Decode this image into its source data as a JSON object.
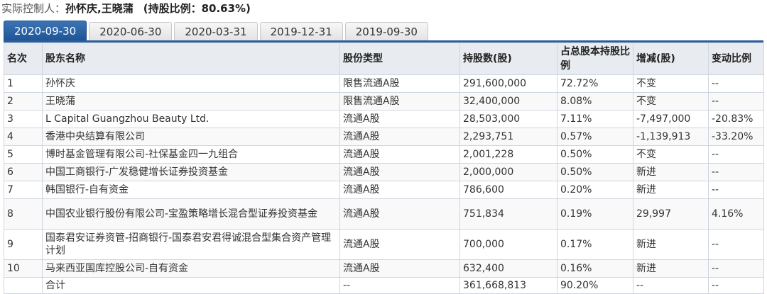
{
  "controller": {
    "label": "实际控制人：",
    "names": "孙怀庆,王晓蒲",
    "ratio": "(持股比例：80.63%)"
  },
  "tabs": [
    {
      "label": "2020-09-30",
      "active": true
    },
    {
      "label": "2020-06-30",
      "active": false
    },
    {
      "label": "2020-03-31",
      "active": false
    },
    {
      "label": "2019-12-31",
      "active": false
    },
    {
      "label": "2019-09-30",
      "active": false
    }
  ],
  "table": {
    "headers": [
      "名次",
      "股东名称",
      "股份类型",
      "持股数(股)",
      "占总股本持股比例",
      "增减(股)",
      "变动比例"
    ],
    "rows": [
      [
        "1",
        "孙怀庆",
        "限售流通A股",
        "291,600,000",
        "72.72%",
        "不变",
        "--"
      ],
      [
        "2",
        "王晓蒲",
        "限售流通A股",
        "32,400,000",
        "8.08%",
        "不变",
        "--"
      ],
      [
        "3",
        "L Capital Guangzhou Beauty Ltd.",
        "流通A股",
        "28,503,000",
        "7.11%",
        "-7,497,000",
        "-20.83%"
      ],
      [
        "4",
        "香港中央结算有限公司",
        "流通A股",
        "2,293,751",
        "0.57%",
        "-1,139,913",
        "-33.20%"
      ],
      [
        "5",
        "博时基金管理有限公司-社保基金四一九组合",
        "流通A股",
        "2,001,228",
        "0.50%",
        "不变",
        "--"
      ],
      [
        "6",
        "中国工商银行-广发稳健增长证券投资基金",
        "流通A股",
        "2,000,000",
        "0.50%",
        "新进",
        "--"
      ],
      [
        "7",
        "韩国银行-自有资金",
        "流通A股",
        "786,600",
        "0.20%",
        "新进",
        "--"
      ],
      [
        "8",
        "中国农业银行股份有限公司-宝盈策略增长混合型证券投资基金",
        "流通A股",
        "751,834",
        "0.19%",
        "29,997",
        "4.16%"
      ],
      [
        "9",
        "国泰君安证券资管-招商银行-国泰君安君得诚混合型集合资产管理计划",
        "流通A股",
        "700,000",
        "0.17%",
        "新进",
        "--"
      ],
      [
        "10",
        "马来西亚国库控股公司-自有资金",
        "流通A股",
        "632,400",
        "0.16%",
        "新进",
        "--"
      ]
    ],
    "total": [
      "",
      "合计",
      "--",
      "361,668,813",
      "90.20%",
      "--",
      "--"
    ]
  }
}
